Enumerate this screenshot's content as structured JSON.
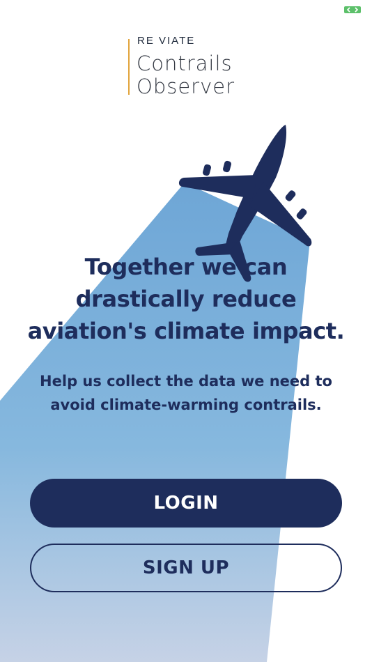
{
  "app": {
    "brand_name": "RE VIATE",
    "product_line1": "Contrails",
    "product_line2": "Observer"
  },
  "hero": {
    "headline_line1": "Together we can",
    "headline_line2": "drastically reduce",
    "headline_line3": "aviation's climate impact.",
    "subline_line1": "Help us collect the data we need to",
    "subline_line2": "avoid climate-warming contrails."
  },
  "actions": {
    "login_label": "LOGIN",
    "signup_label": "SIGN UP"
  },
  "colors": {
    "navy": "#1e2d5c",
    "beam_blue": "#7fb2db",
    "logo_accent": "#e2a43c",
    "battery_green": "#5cc06a"
  },
  "icons": {
    "status": "battery-icon",
    "hero": "airplane-icon"
  }
}
